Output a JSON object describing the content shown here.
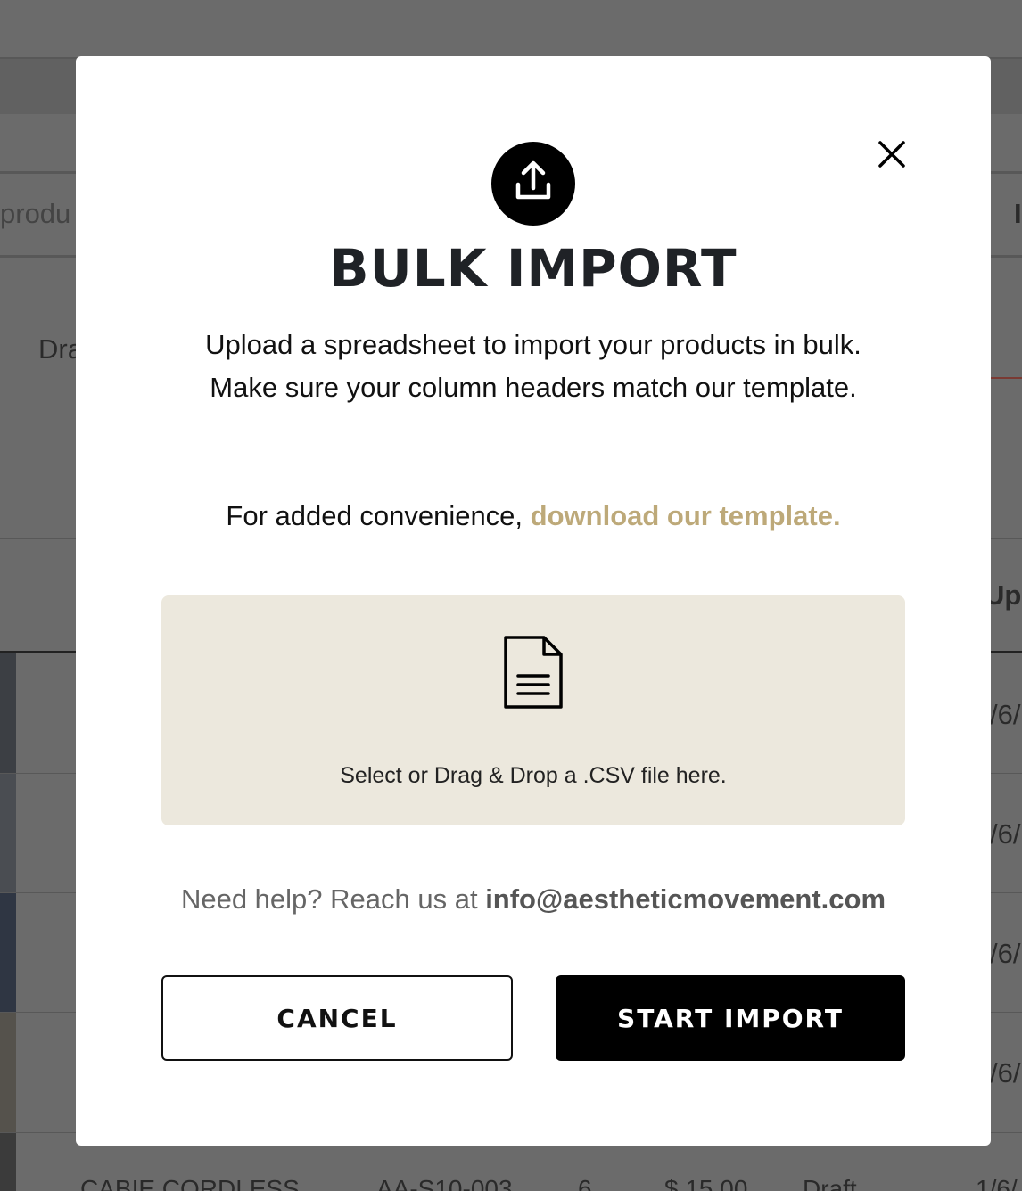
{
  "background": {
    "search_placeholder": "produ",
    "drag_label": "Dra",
    "column_header_partial": "I",
    "updated_header_partial": "Upd",
    "row_dates": [
      "/6/",
      "/6/",
      "/6/",
      "/6/"
    ],
    "last_row": {
      "name": "CABIE CORDLESS",
      "sku": "AA-S10-003",
      "qty": "6",
      "price": "$ 15.00",
      "status": "Draft",
      "date": "1/6/"
    }
  },
  "modal": {
    "title": "BULK IMPORT",
    "description_line1": "Upload a spreadsheet to import your products in bulk.",
    "description_line2": "Make sure your column headers match our template.",
    "convenience_prefix": "For added convenience, ",
    "template_link": "download our template.",
    "dropzone_text": "Select or Drag & Drop a .CSV file here.",
    "help_prefix": "Need help? Reach us at ",
    "help_email": "info@aestheticmovement.com",
    "cancel_label": "CANCEL",
    "start_label": "START IMPORT"
  },
  "icons": {
    "close": "close-icon",
    "upload": "upload-icon",
    "file": "file-icon"
  },
  "colors": {
    "overlay": "#6b6b6b",
    "link": "#bda979",
    "dropzone": "#ece8dd",
    "primary": "#000000"
  }
}
